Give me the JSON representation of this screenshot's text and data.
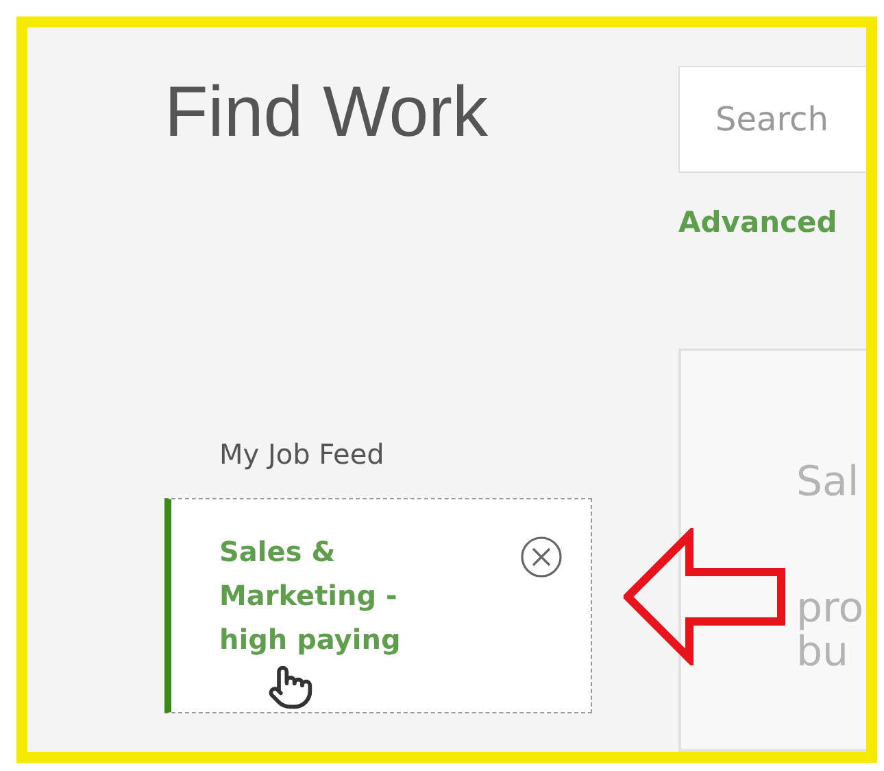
{
  "page_title": "Find Work",
  "search": {
    "placeholder": "Search"
  },
  "advanced_link": "Advanced",
  "feed_heading": "My Job Feed",
  "saved_searches": [
    {
      "label": "Sales & Marketing - high paying",
      "selected": true
    }
  ],
  "job_card": {
    "lines": [
      "Sal",
      "pro",
      "bu"
    ]
  }
}
